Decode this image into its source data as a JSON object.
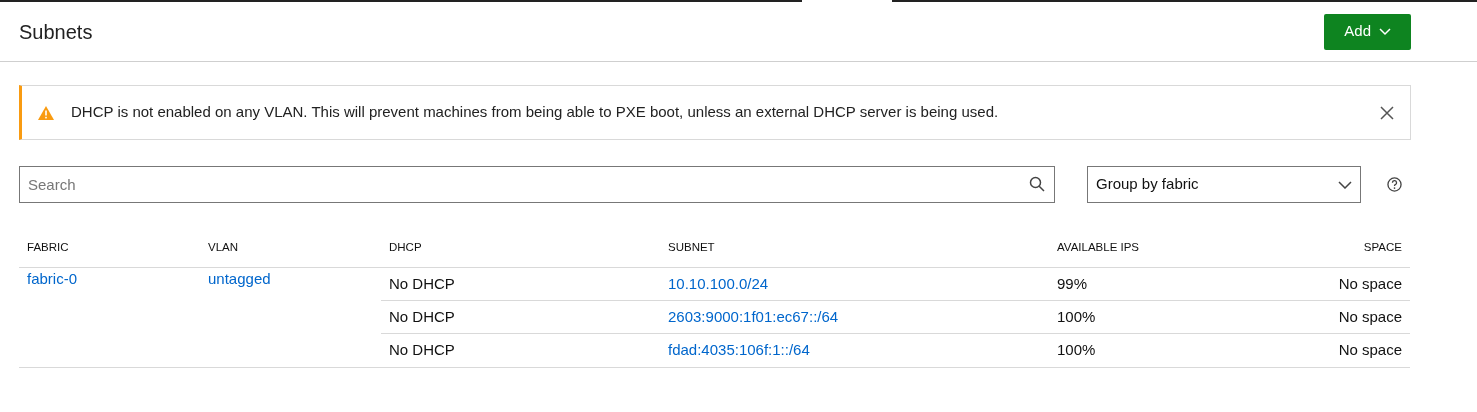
{
  "header": {
    "title": "Subnets",
    "add_button": "Add"
  },
  "notification": {
    "message": "DHCP is not enabled on any VLAN. This will prevent machines from being able to PXE boot, unless an external DHCP server is being used."
  },
  "search": {
    "placeholder": "Search"
  },
  "group_select": {
    "value": "Group by fabric"
  },
  "table": {
    "columns": [
      "FABRIC",
      "VLAN",
      "DHCP",
      "SUBNET",
      "AVAILABLE IPS",
      "SPACE"
    ],
    "groups": [
      {
        "fabric": "fabric-0",
        "vlan": "untagged",
        "subnets": [
          {
            "dhcp": "No DHCP",
            "subnet": "10.10.100.0/24",
            "available_ips": "99%",
            "space": "No space"
          },
          {
            "dhcp": "No DHCP",
            "subnet": "2603:9000:1f01:ec67::/64",
            "available_ips": "100%",
            "space": "No space"
          },
          {
            "dhcp": "No DHCP",
            "subnet": "fdad:4035:106f:1::/64",
            "available_ips": "100%",
            "space": "No space"
          }
        ]
      }
    ]
  }
}
